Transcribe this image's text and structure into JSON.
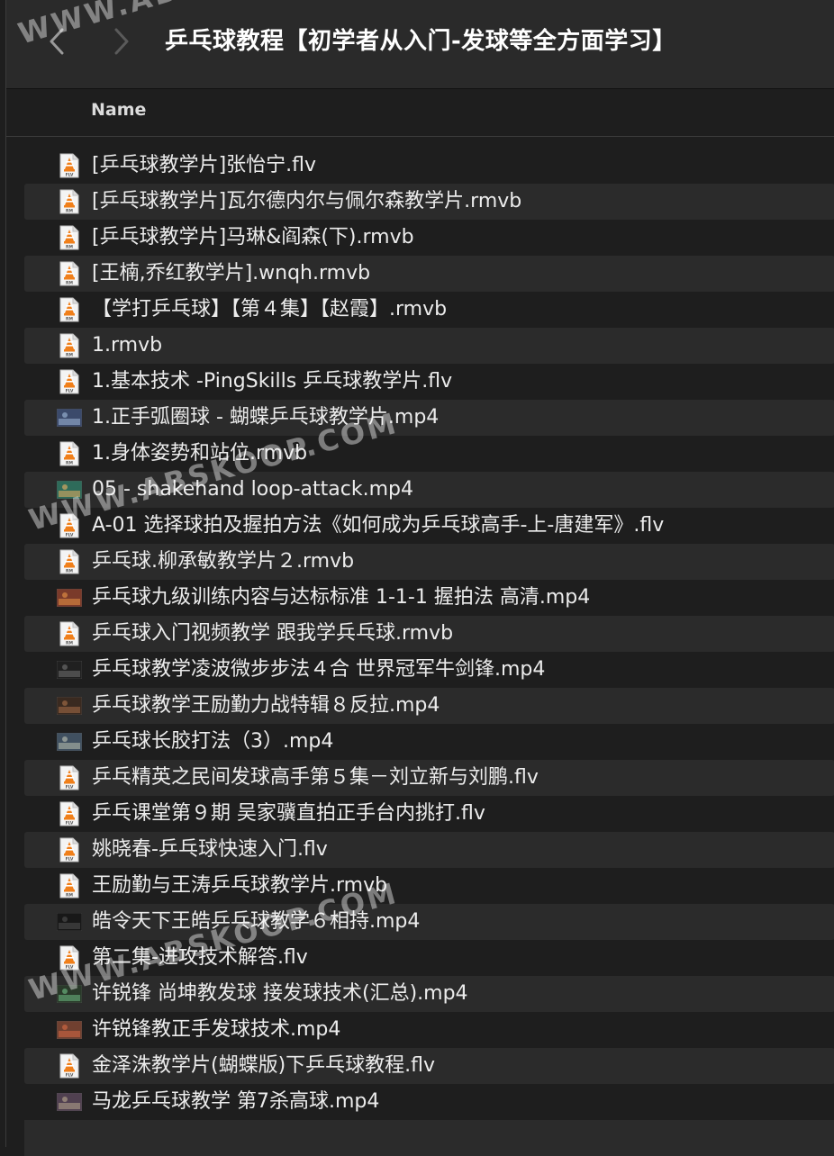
{
  "window": {
    "title": "乒乓球教程【初学者从入门-发球等全方面学习】",
    "column_name": "Name"
  },
  "files": [
    {
      "name": "[乒乓球教学片]张怡宁.flv",
      "icon": "flv-vlc-icon"
    },
    {
      "name": "[乒乓球教学片]瓦尔德内尔与佩尔森教学片.rmvb",
      "icon": "rm-vlc-icon"
    },
    {
      "name": "[乒乓球教学片]马琳&阎森(下).rmvb",
      "icon": "rm-vlc-icon"
    },
    {
      "name": "[王楠,乔红教学片].wnqh.rmvb",
      "icon": "rm-vlc-icon"
    },
    {
      "name": "【学打乒乓球】【第４集】【赵霞】.rmvb",
      "icon": "rm-vlc-icon"
    },
    {
      "name": "1.rmvb",
      "icon": "rm-vlc-icon"
    },
    {
      "name": "1.基本技术 -PingSkills 乒乓球教学片.flv",
      "icon": "flv-vlc-icon"
    },
    {
      "name": "1.正手弧圈球 - 蝴蝶乒乓球教学片.mp4",
      "icon": "video-thumbnail-icon"
    },
    {
      "name": "1.身体姿势和站位.rmvb",
      "icon": "rm-vlc-icon"
    },
    {
      "name": "05 - shakehand loop-attack.mp4",
      "icon": "video-thumbnail-icon"
    },
    {
      "name": "A-01 选择球拍及握拍方法《如何成为乒乓球高手-上-唐建军》.flv",
      "icon": "flv-vlc-icon"
    },
    {
      "name": "乒乓球.柳承敏教学片２.rmvb",
      "icon": "rm-vlc-icon"
    },
    {
      "name": "乒乓球九级训练内容与达标标准 1-1-1 握拍法 高清.mp4",
      "icon": "video-thumbnail-icon"
    },
    {
      "name": "乒乓球入门视频教学 跟我学兵乓球.rmvb",
      "icon": "rm-vlc-icon"
    },
    {
      "name": "乒乓球教学凌波微步步法４合 世界冠军牛剑锋.mp4",
      "icon": "video-thumbnail-icon"
    },
    {
      "name": "乒乓球教学王励勤力战特辑８反拉.mp4",
      "icon": "video-thumbnail-icon"
    },
    {
      "name": "乒乓球长胶打法（3）.mp4",
      "icon": "video-thumbnail-icon"
    },
    {
      "name": "乒乓精英之民间发球高手第５集－刘立新与刘鹏.flv",
      "icon": "flv-vlc-icon"
    },
    {
      "name": "乒乓课堂第９期 吴家骥直拍正手台内挑打.flv",
      "icon": "flv-vlc-icon"
    },
    {
      "name": "姚晓春-乒乓球快速入门.flv",
      "icon": "flv-vlc-icon"
    },
    {
      "name": "王励勤与王涛乒乓球教学片.rmvb",
      "icon": "rm-vlc-icon"
    },
    {
      "name": "皓令天下王皓乒乓球教学６相持.mp4",
      "icon": "video-thumbnail-icon"
    },
    {
      "name": "第二集-进攻技术解答.flv",
      "icon": "flv-vlc-icon"
    },
    {
      "name": "许锐锋 尚坤教发球 接发球技术(汇总).mp4",
      "icon": "video-thumbnail-icon"
    },
    {
      "name": "许锐锋教正手发球技术.mp4",
      "icon": "video-thumbnail-icon"
    },
    {
      "name": "金泽洙教学片(蝴蝶版)下乒乓球教程.flv",
      "icon": "flv-vlc-icon"
    },
    {
      "name": "马龙乒乓球教学 第7杀高球.mp4",
      "icon": "video-thumbnail-icon"
    }
  ],
  "watermark": "WWW.ABSKOOP.COM",
  "colors": {
    "background": "#1e1e1e",
    "titlebar": "#2a2a2a",
    "alt_row": "#2b2b2b",
    "vlc_orange": "#f07f1a"
  }
}
